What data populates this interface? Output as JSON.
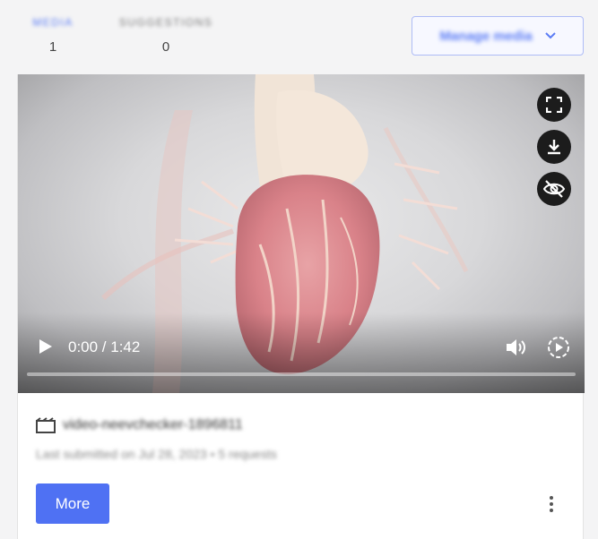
{
  "tabs": [
    {
      "label": "MEDIA",
      "count": "1"
    },
    {
      "label": "SUGGESTIONS",
      "count": "0"
    }
  ],
  "manage_button": {
    "label": "Manage media"
  },
  "video": {
    "time": "0:00 / 1:42",
    "progress": 0
  },
  "media": {
    "title": "video-neevchecker-1896811",
    "subtitle": "Last submitted on Jul 28, 2023  •  5 requests"
  },
  "actions": {
    "more_label": "More"
  },
  "colors": {
    "accent": "#4f71f3",
    "tab_active": "#5b7cf5"
  },
  "icons": [
    "fullscreen-icon",
    "download-icon",
    "eye-off-icon",
    "play-icon",
    "volume-icon",
    "playback-speed-icon",
    "video-file-icon",
    "kebab-menu-icon",
    "chevron-down-icon"
  ]
}
